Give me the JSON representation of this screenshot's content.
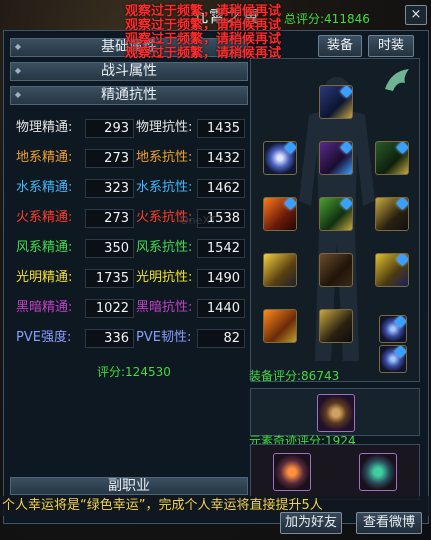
{
  "header": {
    "title": "九霄之翼",
    "score": "总评分:411846",
    "close_label": "×"
  },
  "warnings": [
    "观察过于频繁，请稍候再试",
    "观察过于频繁，请稍候再试",
    "观察过于频繁，请稍候再试",
    "观察过于频繁，请稍候再试"
  ],
  "categories": {
    "basic": "基础属性",
    "combat": "战斗属性",
    "mastery": "精通抗性"
  },
  "stats": [
    {
      "l1": "物理精通:",
      "v1": "293",
      "l2": "物理抗性:",
      "v2": "1435",
      "c1": "#e6e6e6",
      "c2": "#e6e6e6"
    },
    {
      "l1": "地系精通:",
      "v1": "273",
      "l2": "地系抗性:",
      "v2": "1432",
      "c1": "#f0a030",
      "c2": "#f0a030"
    },
    {
      "l1": "水系精通:",
      "v1": "323",
      "l2": "水系抗性:",
      "v2": "1462",
      "c1": "#3fb8ff",
      "c2": "#3fb8ff"
    },
    {
      "l1": "火系精通:",
      "v1": "273",
      "l2": "火系抗性:",
      "v2": "1538",
      "c1": "#ff3b2a",
      "c2": "#ff3b2a"
    },
    {
      "l1": "风系精通:",
      "v1": "350",
      "l2": "风系抗性:",
      "v2": "1542",
      "c1": "#3fdc4f",
      "c2": "#3fdc4f"
    },
    {
      "l1": "光明精通:",
      "v1": "1735",
      "l2": "光明抗性:",
      "v2": "1490",
      "c1": "#f3e02a",
      "c2": "#f3e02a"
    },
    {
      "l1": "黑暗精通:",
      "v1": "1022",
      "l2": "黑暗抗性:",
      "v2": "1440",
      "c1": "#c040c8",
      "c2": "#c040c8"
    },
    {
      "l1": "PVE强度:",
      "v1": "336",
      "l2": "PVE韧性:",
      "v2": "82",
      "c1": "#8a9cff",
      "c2": "#8a9cff"
    }
  ],
  "left_score": "评分:124530",
  "sub_job": "副职业",
  "tabs": {
    "equip": "装备",
    "fashion": "时装"
  },
  "equip_score": "装备评分:86743",
  "element_score": "元素奇迹评分:1924",
  "marquee": "个人幸运将是“绿色幸运”，完成个人幸运将直接提升5人",
  "buttons": {
    "add_friend": "加为好友",
    "view_blog": "查看微博"
  },
  "watermark": "OneXT"
}
